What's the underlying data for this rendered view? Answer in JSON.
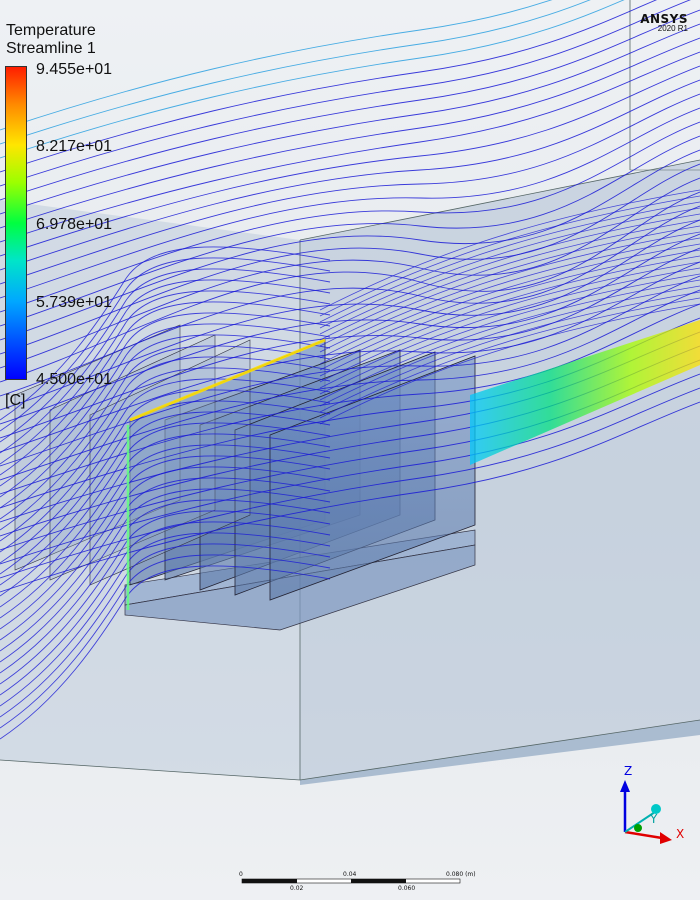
{
  "legend": {
    "title_line1": "Temperature",
    "title_line2": "Streamline 1",
    "labels": [
      "9.455e+01",
      "8.217e+01",
      "6.978e+01",
      "5.739e+01",
      "4.500e+01"
    ],
    "unit": "[C]",
    "colors": [
      "#ff1e00",
      "#ff8a00",
      "#ffe600",
      "#9cff00",
      "#00ff40",
      "#00e5c8",
      "#00a8ff",
      "#0050ff",
      "#0000ff"
    ]
  },
  "logo": {
    "brand": "ANSYS",
    "version": "2020 R1"
  },
  "triad": {
    "z_label": "Z",
    "y_label": "Y",
    "x_label": "X"
  },
  "scale_bar": {
    "top_labels": [
      "0",
      "0.04",
      "0.080 (m)"
    ],
    "bottom_labels": [
      "0.02",
      "0.060"
    ]
  },
  "colors": {
    "streamline": "#1a1ad6",
    "domain_box": "#b8c8da",
    "heatsink": "#6f8fb6"
  }
}
